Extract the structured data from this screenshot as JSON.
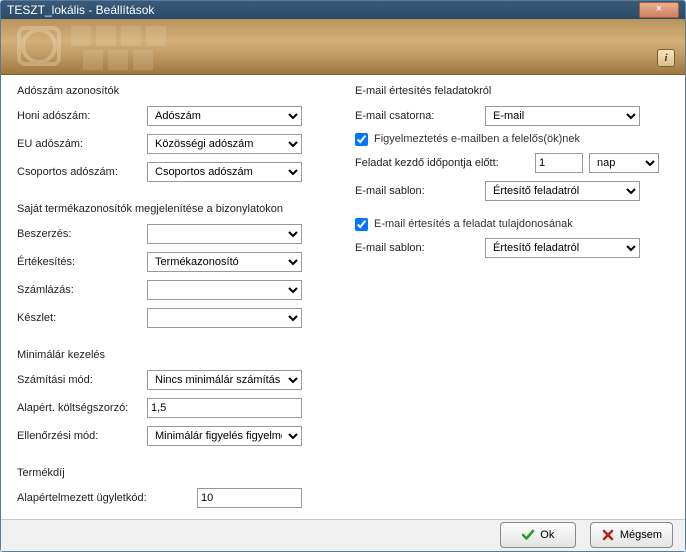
{
  "window": {
    "title": "TESZT_lokális - Beállítások",
    "close_glyph": "×"
  },
  "left": {
    "group_tax": {
      "title": "Adószám azonosítók",
      "home_label": "Honi adószám:",
      "home_value": "Adószám",
      "eu_label": "EU adószám:",
      "eu_value": "Közösségi adószám",
      "group_label": "Csoportos adószám:",
      "group_value": "Csoportos adószám"
    },
    "group_prodid": {
      "title": "Saját termékazonosítók megjelenítése a bizonylatokon",
      "beszerzes_label": "Beszerzés:",
      "beszerzes_value": "",
      "ertekesites_label": "Értékesítés:",
      "ertekesites_value": "Termékazonosító",
      "szamlazas_label": "Számlázás:",
      "szamlazas_value": "",
      "keszlet_label": "Készlet:",
      "keszlet_value": ""
    },
    "group_minprice": {
      "title": "Minimálár kezelés",
      "calc_label": "Számítási mód:",
      "calc_value": "Nincs minimálár számítás",
      "mult_label": "Alapért. költségszorzó:",
      "mult_value": "1,5",
      "check_label": "Ellenőrzési mód:",
      "check_value": "Minimálár figyelés figyelmezt"
    },
    "group_termekdij": {
      "title": "Termékdíj",
      "default_code_label": "Alapértelmezett ügyletkód:",
      "default_code_value": "10"
    }
  },
  "right": {
    "group_email": {
      "title": "E-mail értesítés feladatokról",
      "channel_label": "E-mail csatorna:",
      "channel_value": "E-mail",
      "warn_checkbox_label": "Figyelmeztetés e-mailben a felelős(ök)nek",
      "warn_checked": true,
      "before_label": "Feladat kezdő időpontja előtt:",
      "before_value": "1",
      "before_unit": "nap",
      "template1_label": "E-mail sablon:",
      "template1_value": "Értesítő feladatról",
      "owner_checkbox_label": "E-mail értesítés a feladat tulajdonosának",
      "owner_checked": true,
      "template2_label": "E-mail sablon:",
      "template2_value": "Értesítő feladatról"
    }
  },
  "footer": {
    "ok_label": "Ok",
    "cancel_label": "Mégsem"
  }
}
